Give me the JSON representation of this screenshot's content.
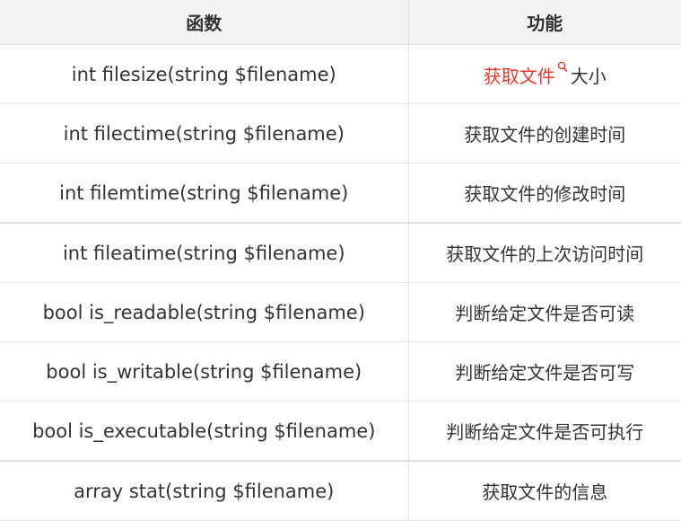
{
  "table": {
    "headers": {
      "function": "函数",
      "description": "功能"
    },
    "rows": [
      {
        "function": "int filesize(string $filename)",
        "description": "获取文件大小",
        "link_text": "获取文件",
        "rest_text": "大小"
      },
      {
        "function": "int filectime(string $filename)",
        "description": "获取文件的创建时间"
      },
      {
        "function": "int filemtime(string $filename)",
        "description": "获取文件的修改时间"
      },
      {
        "function": "int fileatime(string $filename)",
        "description": "获取文件的上次访问时间"
      },
      {
        "function": "bool is_readable(string $filename)",
        "description": "判断给定文件是否可读"
      },
      {
        "function": "bool is_writable(string $filename)",
        "description": "判断给定文件是否可写"
      },
      {
        "function": "bool is_executable(string $filename)",
        "description": "判断给定文件是否可执行"
      },
      {
        "function": "array stat(string $filename)",
        "description": "获取文件的信息"
      }
    ]
  },
  "colors": {
    "link": "#e5392f",
    "header_bg": "#f2f2f2",
    "text": "#333333"
  },
  "icons": {
    "inline_search": "search-icon"
  }
}
